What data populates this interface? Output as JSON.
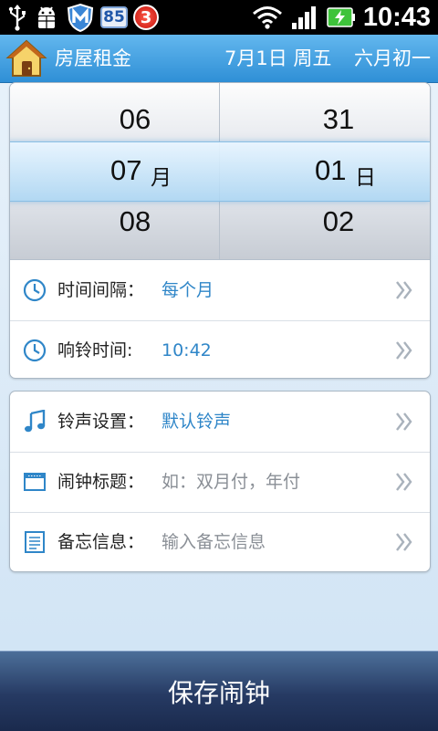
{
  "status_bar": {
    "left_icons": [
      "usb-icon",
      "android-debug-icon",
      "shield-m-icon"
    ],
    "badge_85": "85",
    "badge_3": "3",
    "right_icons": [
      "wifi-icon",
      "signal-icon",
      "battery-charging-icon"
    ],
    "time": "10:43"
  },
  "header": {
    "title": "房屋租金",
    "date": "7月1日 周五",
    "lunar_date": "六月初一"
  },
  "picker": {
    "month": {
      "prev": "06",
      "selected": "07",
      "next": "08",
      "unit": "月"
    },
    "day": {
      "prev": "31",
      "selected": "01",
      "next": "02",
      "unit": "日"
    }
  },
  "settings_group_1": [
    {
      "label": "时间间隔：",
      "value": "每个月",
      "icon": "clock-icon"
    },
    {
      "label": "响铃时间:",
      "value": "10:42",
      "icon": "clock-icon"
    }
  ],
  "settings_group_2": [
    {
      "label": "铃声设置：",
      "value": "默认铃声",
      "icon": "music-note-icon"
    },
    {
      "label": "闹钟标题：",
      "placeholder": "如：双月付，年付",
      "icon": "window-icon"
    },
    {
      "label": "备忘信息：",
      "placeholder": "输入备忘信息",
      "icon": "memo-icon"
    }
  ],
  "save_button": "保存闹钟",
  "colors": {
    "accent_blue": "#2f86c8",
    "title_bar": "#3f9fe0",
    "save_bar": "#263a63"
  }
}
